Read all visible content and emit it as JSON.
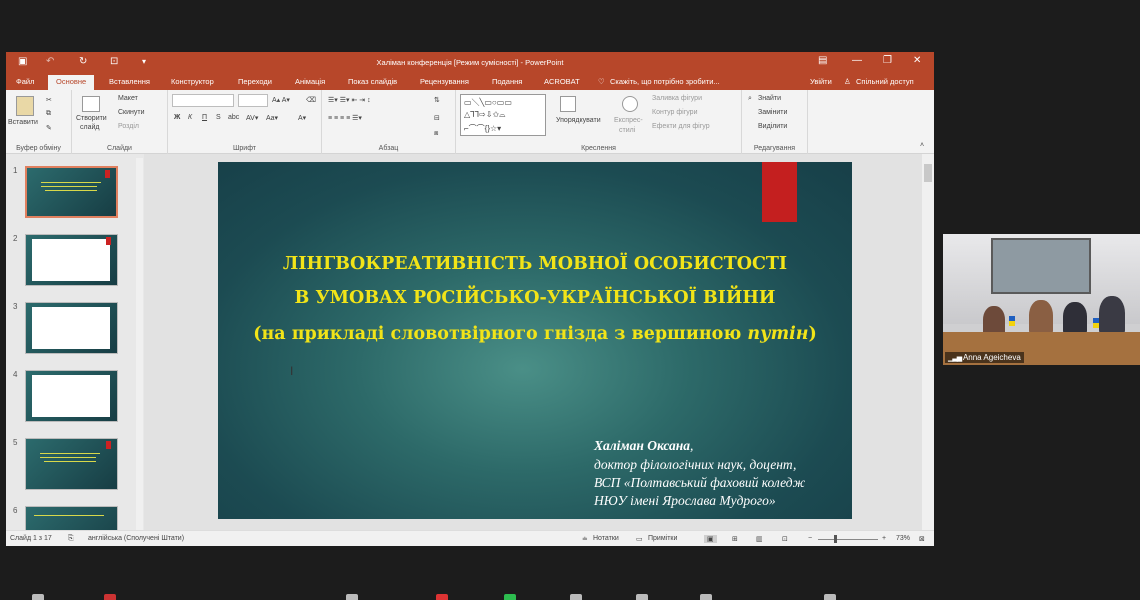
{
  "window": {
    "title": "Халіман конференція [Режим сумісності] - PowerPoint",
    "qa_icons": [
      "save-icon",
      "undo-icon",
      "redo-icon",
      "present-icon",
      "customize-icon"
    ],
    "controls": [
      "ribbon-options-icon",
      "minimize-icon",
      "restore-icon",
      "close-icon"
    ]
  },
  "tabs": [
    {
      "label": "Файл"
    },
    {
      "label": "Основне",
      "active": true
    },
    {
      "label": "Вставлення"
    },
    {
      "label": "Конструктор"
    },
    {
      "label": "Переходи"
    },
    {
      "label": "Анімація"
    },
    {
      "label": "Показ слайдів"
    },
    {
      "label": "Рецензування"
    },
    {
      "label": "Подання"
    },
    {
      "label": "ACROBAT"
    }
  ],
  "tell_me": "Скажіть, що потрібно зробити...",
  "signin": "Увійти",
  "share": "Спільний доступ",
  "ribbon": {
    "clipboard": {
      "paste": "Вставити",
      "label": "Буфер обміну"
    },
    "slides": {
      "new_slide_1": "Створити",
      "new_slide_2": "слайд",
      "layout": "Макет",
      "reset": "Скинути",
      "section": "Розділ",
      "label": "Слайди"
    },
    "font": {
      "label": "Шрифт"
    },
    "paragraph": {
      "label": "Абзац"
    },
    "drawing": {
      "arrange": "Упорядкувати",
      "quick_styles_1": "Експрес-",
      "quick_styles_2": "стилі",
      "fill": "Заливка фігури",
      "outline": "Контур фігури",
      "effects": "Ефекти для фігур",
      "label": "Креслення"
    },
    "editing": {
      "find": "Знайти",
      "replace": "Замінити",
      "select": "Виділити",
      "label": "Редагування"
    }
  },
  "thumbnails": [
    "1",
    "2",
    "3",
    "4",
    "5",
    "6"
  ],
  "slide": {
    "title_line1": "ЛІНГВОКРЕАТИВНІСТЬ МОВНОЇ ОСОБИСТОСТІ",
    "title_line2": "В УМОВАХ РОСІЙСЬКО-УКРАЇНСЬКОЇ ВІЙНИ",
    "title_line3_a": "(на прикладі словотвірного гнізда з вершиною ",
    "title_line3_b": "путін",
    "title_line3_c": ")",
    "author_name": "Халіман Оксана",
    "author_comma": ",",
    "author_line2": "доктор філологічних наук, доцент,",
    "author_line3": "ВСП «Полтавський фаховий коледж",
    "author_line4": "НЮУ імені Ярослава Мудрого»"
  },
  "status": {
    "slide_counter": "Слайд 1 з 17",
    "language": "англійська (Сполучені Штати)",
    "notes": "Нотатки",
    "comments": "Примітки",
    "zoom": "73%"
  },
  "video": {
    "participant": "Anna Ageicheva"
  },
  "colors": {
    "accent": "#b7472a",
    "slide_title": "#f2e418",
    "slide_bg": "#2d6a69",
    "redbar": "#c41f1f"
  }
}
